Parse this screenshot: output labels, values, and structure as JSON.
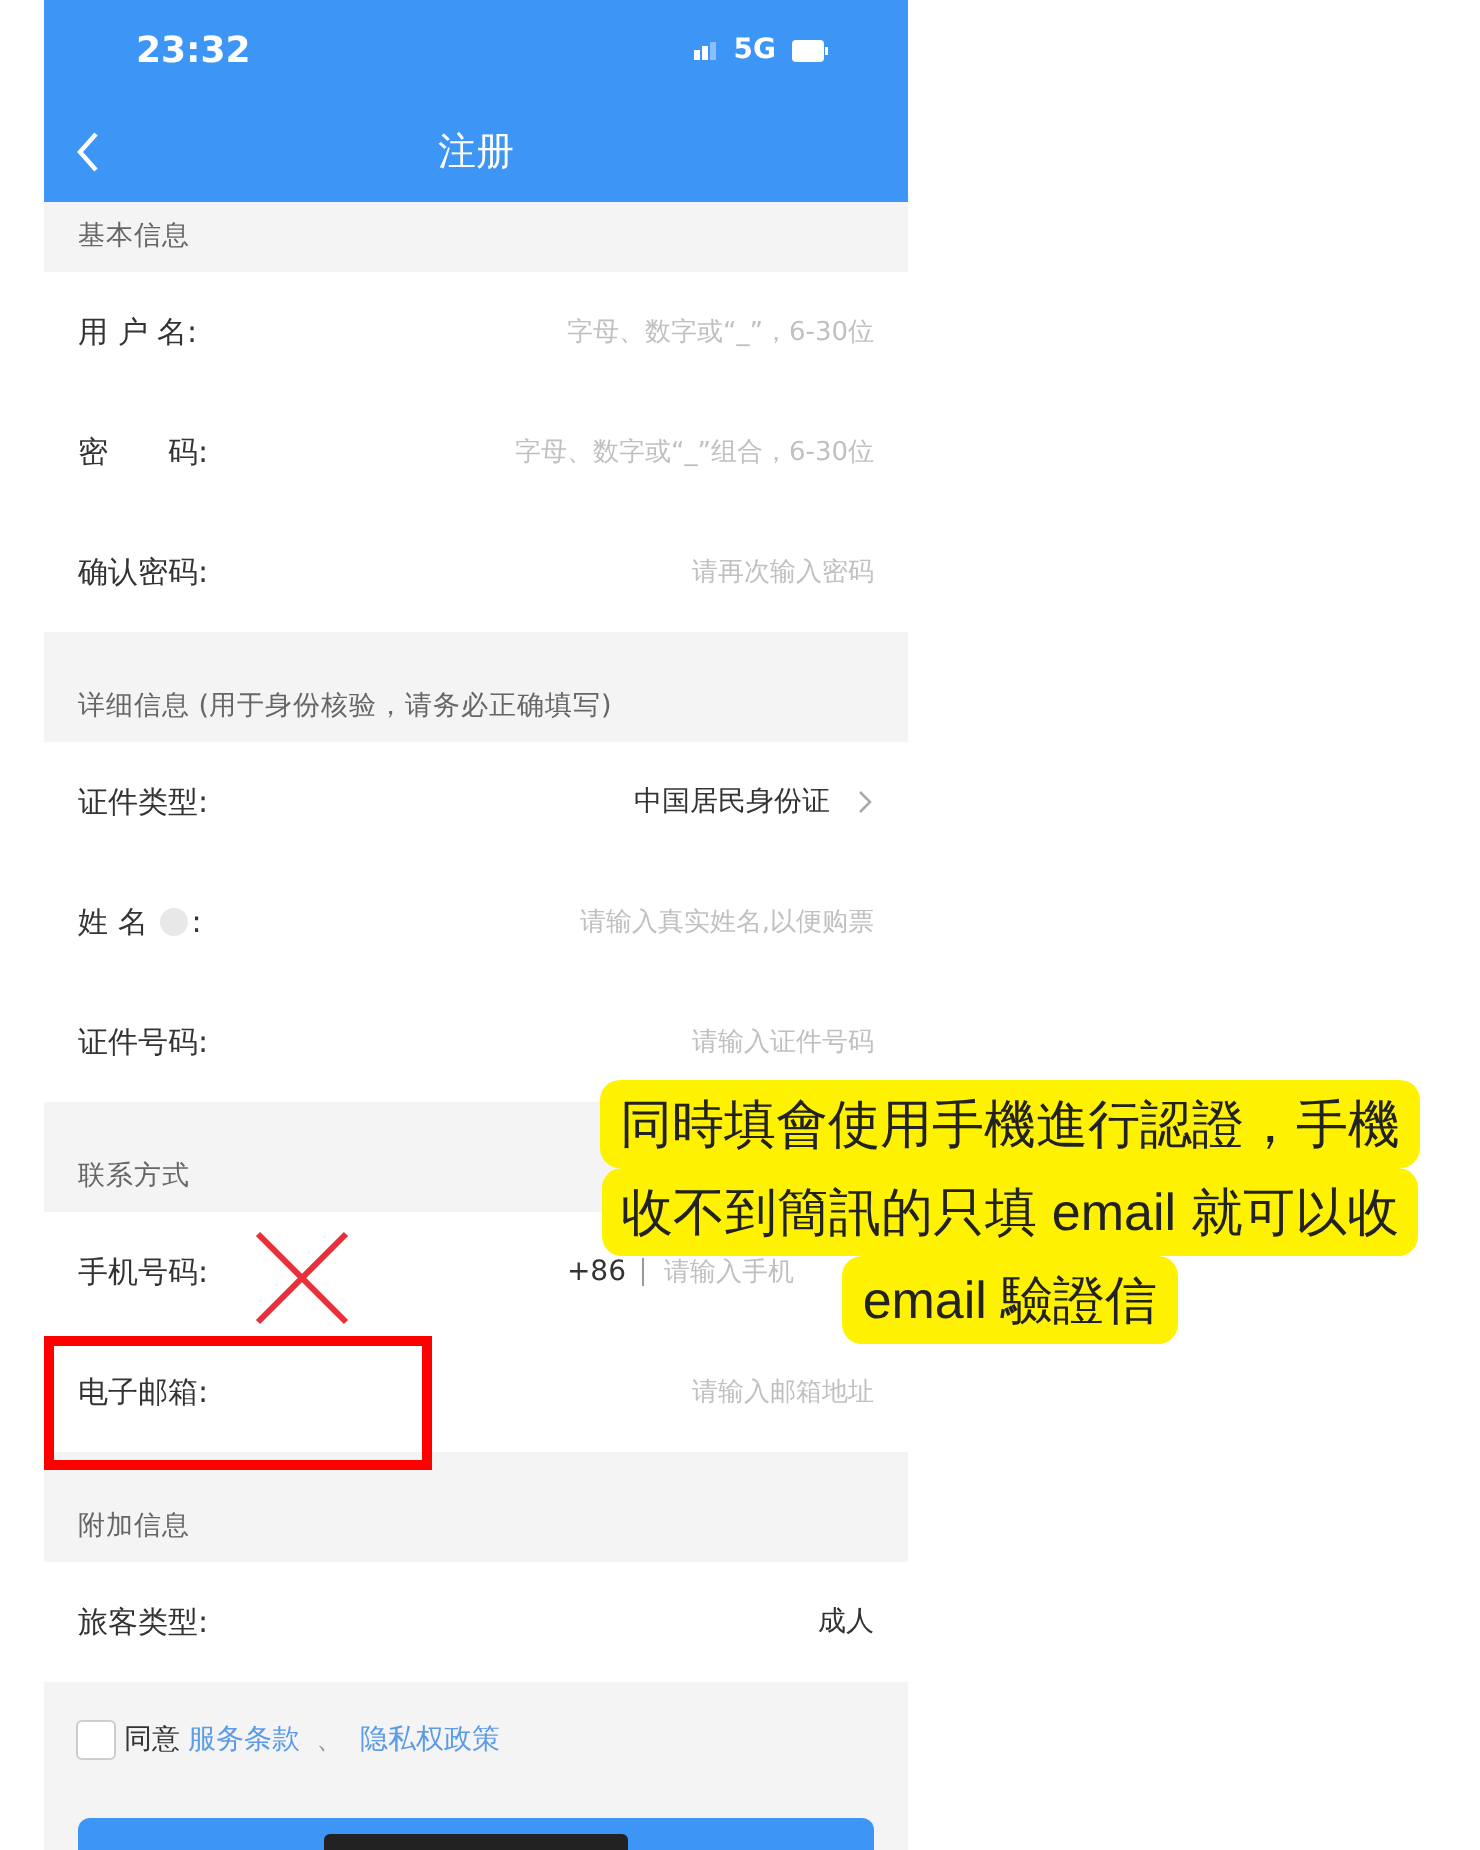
{
  "status_bar": {
    "time": "23:32",
    "network": "5G"
  },
  "nav": {
    "title": "注册"
  },
  "sections": [
    {
      "title": "基本信息",
      "rows": [
        {
          "kind": "input",
          "label": "用 户 名:",
          "placeholder": "字母、数字或“_”，6-30位"
        },
        {
          "kind": "input",
          "label": "密　　码:",
          "placeholder": "字母、数字或“_”组合，6-30位"
        },
        {
          "kind": "input",
          "label": "确认密码:",
          "placeholder": "请再次输入密码"
        }
      ]
    },
    {
      "title": "详细信息 (用于身份核验，请务必正确填写)",
      "rows": [
        {
          "kind": "select",
          "label": "证件类型:",
          "value": "中国居民身份证"
        },
        {
          "kind": "input",
          "label": "姓 名",
          "help_icon": true,
          "label_end": ":",
          "placeholder": "请输入真实姓名,以便购票"
        },
        {
          "kind": "input",
          "label": "证件号码:",
          "placeholder": "请输入证件号码"
        }
      ]
    },
    {
      "title": "联系方式",
      "rows": [
        {
          "kind": "phone",
          "label": "手机号码:",
          "prefix": "+86",
          "placeholder": "请输入手机"
        },
        {
          "kind": "input",
          "label": "电子邮箱:",
          "placeholder": "请输入邮箱地址"
        }
      ]
    },
    {
      "title": "附加信息",
      "rows": [
        {
          "kind": "value",
          "label": "旅客类型:",
          "value": "成人"
        }
      ]
    }
  ],
  "agreement": {
    "checked": false,
    "prefix": "同意",
    "links": [
      "服务条款",
      "隐私权政策"
    ],
    "separator": "、"
  },
  "annotation": {
    "lines": [
      "同時填會使用手機進行認證，手機",
      "收不到簡訊的只填 email 就可以收",
      "email 驗證信"
    ]
  }
}
